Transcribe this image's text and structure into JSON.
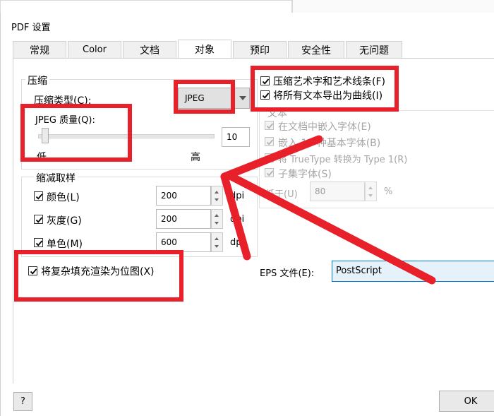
{
  "dialog": {
    "title": "PDF 设置"
  },
  "tabs": [
    {
      "label": "常规",
      "active": false
    },
    {
      "label": "Color",
      "active": false
    },
    {
      "label": "文档",
      "active": false
    },
    {
      "label": "对象",
      "active": true
    },
    {
      "label": "预印",
      "active": false
    },
    {
      "label": "安全性",
      "active": false
    },
    {
      "label": "无问题",
      "active": false
    }
  ],
  "compression": {
    "group_label": "压缩",
    "type_label": "压缩类型(C):",
    "type_value": "JPEG",
    "quality_label": "JPEG 质量(Q):",
    "quality_value": "10",
    "slider_min_label": "低",
    "slider_max_label": "高",
    "slider_level_fraction": 0.02
  },
  "downsample": {
    "group_label": "缩减取样",
    "rows": [
      {
        "label": "颜色(L)",
        "value": "200",
        "unit": "dpi",
        "checked": true
      },
      {
        "label": "灰度(G)",
        "value": "200",
        "unit": "dpi",
        "checked": true
      },
      {
        "label": "单色(M)",
        "value": "600",
        "unit": "dpi",
        "checked": true
      }
    ]
  },
  "right_options": {
    "compress_art": {
      "label": "压缩艺术字和艺术线条(F)",
      "checked": true
    },
    "export_curves": {
      "label": "将所有文本导出为曲线(I)",
      "checked": true
    }
  },
  "text_group": {
    "group_label": "文本",
    "items": [
      {
        "label": "在文档中嵌入字体(E)",
        "checked": true
      },
      {
        "label": "嵌入 14 种基本字体(B)",
        "checked": true
      },
      {
        "label": "将 TrueType 转换为 Type 1(R)",
        "checked": true
      },
      {
        "label": "子集字体(S)",
        "checked": true
      }
    ],
    "below_label": "低于(U)",
    "below_value": "80",
    "below_unit": "%"
  },
  "complex_fill": {
    "label": "将复杂填充渲染为位图(X)",
    "checked": true
  },
  "eps": {
    "label": "EPS 文件(E):",
    "value": "PostScript"
  },
  "buttons": {
    "help": "?",
    "ok": "OK"
  },
  "colors": {
    "annotation_red": "#e8202a",
    "arrow_red": "#e8202a"
  }
}
